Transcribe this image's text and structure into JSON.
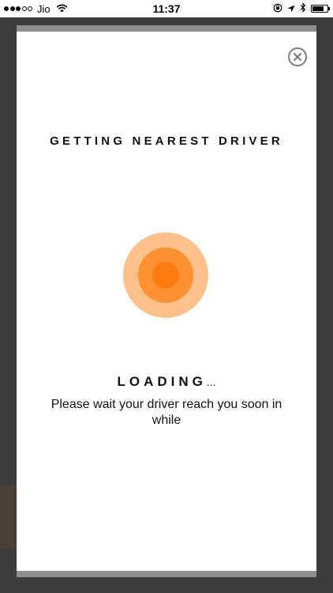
{
  "status_bar": {
    "carrier": "Jio",
    "time": "11:37",
    "signal_filled": 3,
    "signal_total": 5,
    "battery_level": 0.8,
    "icons": [
      "wifi-icon",
      "orientation-lock-icon",
      "location-arrow-icon",
      "bluetooth-icon",
      "battery-icon"
    ]
  },
  "modal": {
    "title": "GETTING NEAREST DRIVER",
    "loading_label": "LOADING",
    "loading_suffix": "...",
    "message": "Please wait your driver reach you soon in while",
    "close_icon": "close-icon"
  },
  "colors": {
    "pulse_outer": "#ffc08a",
    "pulse_middle": "#ff9133",
    "pulse_inner": "#ff7a0d",
    "modal_border": "#8d8d8d",
    "backdrop": "#3c3c3c"
  }
}
